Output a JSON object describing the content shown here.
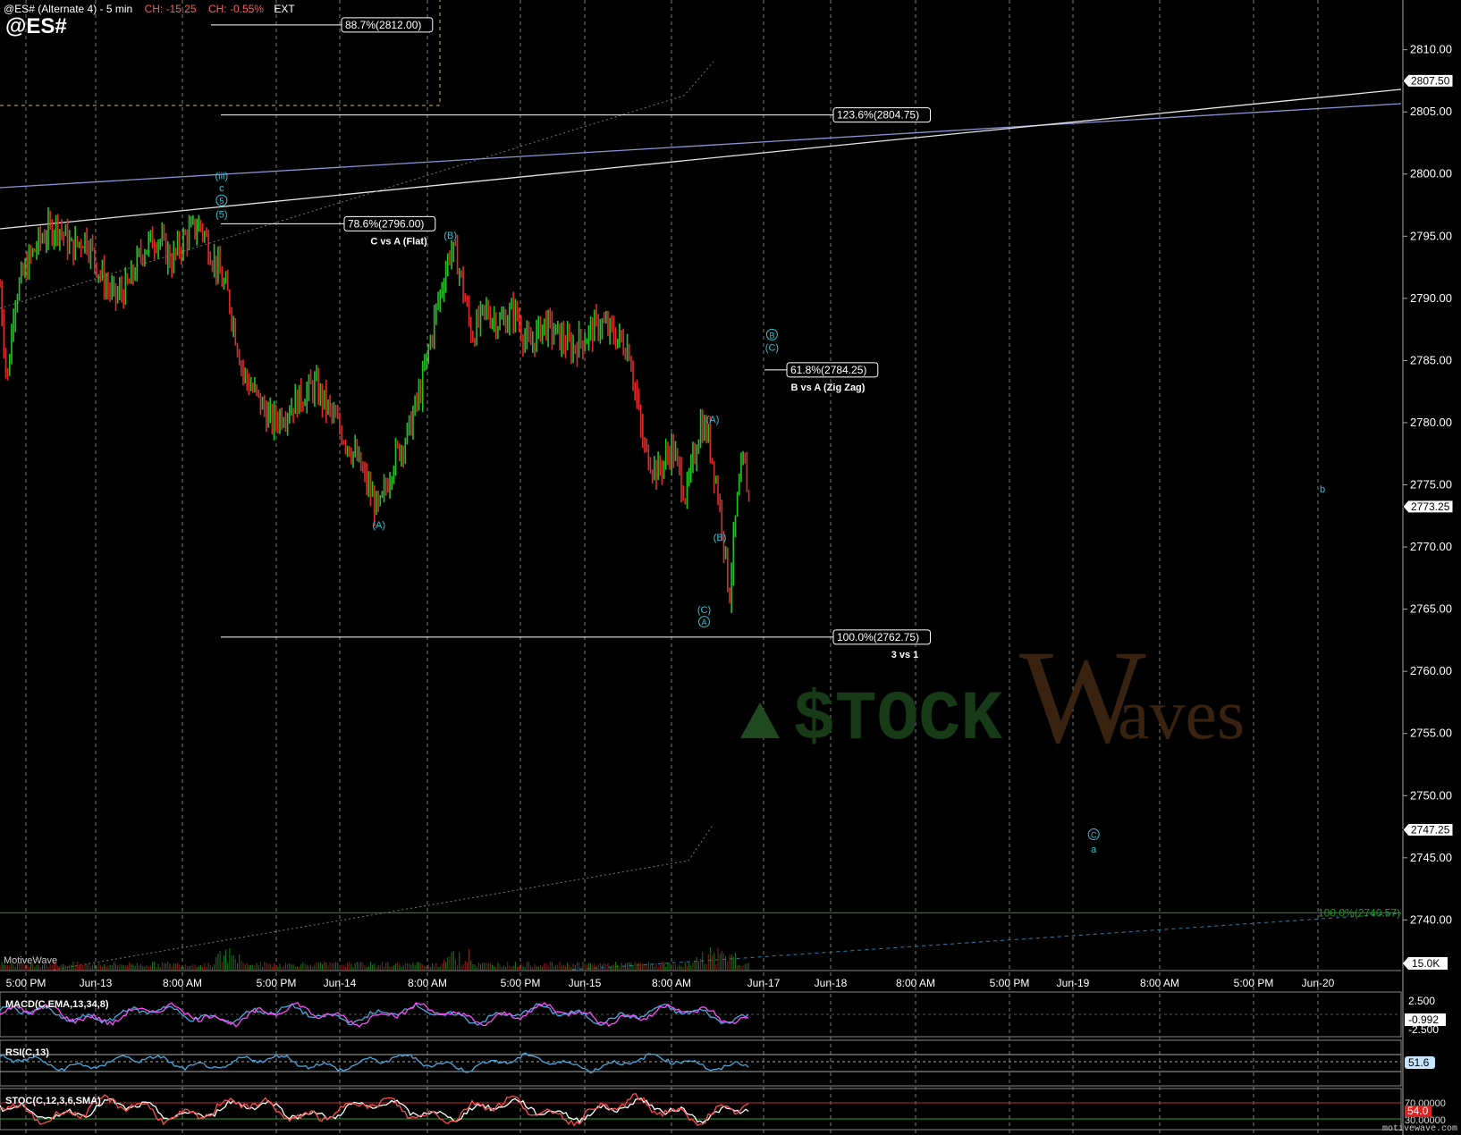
{
  "header": {
    "title": "@ES# (Alternate 4) - 5 min",
    "change_points": "CH: -15.25",
    "change_percent": "CH: -0.55%",
    "ext": "EXT",
    "symbol": "@ES#"
  },
  "brand": "MotiveWave",
  "site": "motivewave.com",
  "watermark": {
    "left": "$TOCK",
    "right_initial": "W",
    "right_rest": "aves"
  },
  "colors": {
    "background": "#000000",
    "up_bar": "#22c522",
    "down_bar": "#e02b2b",
    "wave_label": "#2fc6dc",
    "grid": "#9a9a9a",
    "channel_blue": "#8d94d6",
    "trend_white": "#e6e6e6",
    "fib_green": "#1f9a1f",
    "macd_line": "#ff4dff",
    "signal_line": "#46a9e0",
    "rsi_line": "#46a9e0",
    "stoch_k": "#ff4d4d",
    "stoch_d": "#ffffff"
  },
  "chart_data": {
    "type": "candlestick",
    "title": "@ES# (Alternate 4) - 5 min",
    "interval": "5 min",
    "ylim": [
      2736,
      2814
    ],
    "y_ticks": [
      "2740.00",
      "2745.00",
      "2750.00",
      "2755.00",
      "2760.00",
      "2765.00",
      "2770.00",
      "2775.00",
      "2780.00",
      "2785.00",
      "2790.00",
      "2795.00",
      "2800.00",
      "2805.00",
      "2810.00"
    ],
    "x_ticks": [
      "5:00 PM",
      "Jun-13",
      "8:00 AM",
      "5:00 PM",
      "Jun-14",
      "8:00 AM",
      "5:00 PM",
      "Jun-15",
      "8:00 AM",
      "Jun-17",
      "Jun-18",
      "8:00 AM",
      "5:00 PM",
      "Jun-19",
      "8:00 AM",
      "5:00 PM",
      "Jun-20"
    ],
    "price_path": [
      {
        "t": 0,
        "p": 2791
      },
      {
        "t": 1,
        "p": 2783
      },
      {
        "t": 2,
        "p": 2790
      },
      {
        "t": 4,
        "p": 2793
      },
      {
        "t": 6,
        "p": 2795
      },
      {
        "t": 8,
        "p": 2796
      },
      {
        "t": 10,
        "p": 2794
      },
      {
        "t": 12,
        "p": 2795
      },
      {
        "t": 14,
        "p": 2792
      },
      {
        "t": 16,
        "p": 2790
      },
      {
        "t": 18,
        "p": 2791
      },
      {
        "t": 20,
        "p": 2794
      },
      {
        "t": 22,
        "p": 2795
      },
      {
        "t": 24,
        "p": 2793
      },
      {
        "t": 26,
        "p": 2795
      },
      {
        "t": 28,
        "p": 2796
      },
      {
        "t": 30,
        "p": 2793
      },
      {
        "t": 32,
        "p": 2790
      },
      {
        "t": 34,
        "p": 2784
      },
      {
        "t": 36,
        "p": 2782
      },
      {
        "t": 38,
        "p": 2780
      },
      {
        "t": 40,
        "p": 2781
      },
      {
        "t": 42,
        "p": 2782
      },
      {
        "t": 44,
        "p": 2783
      },
      {
        "t": 46,
        "p": 2781
      },
      {
        "t": 48,
        "p": 2779
      },
      {
        "t": 50,
        "p": 2777
      },
      {
        "t": 52,
        "p": 2774
      },
      {
        "t": 53,
        "p": 2772.75
      },
      {
        "t": 55,
        "p": 2777
      },
      {
        "t": 57,
        "p": 2779
      },
      {
        "t": 59,
        "p": 2783
      },
      {
        "t": 61,
        "p": 2789
      },
      {
        "t": 63,
        "p": 2794
      },
      {
        "t": 64,
        "p": 2793
      },
      {
        "t": 66,
        "p": 2787
      },
      {
        "t": 68,
        "p": 2789
      },
      {
        "t": 70,
        "p": 2788
      },
      {
        "t": 72,
        "p": 2789
      },
      {
        "t": 74,
        "p": 2786
      },
      {
        "t": 76,
        "p": 2788
      },
      {
        "t": 78,
        "p": 2787
      },
      {
        "t": 80,
        "p": 2786
      },
      {
        "t": 82,
        "p": 2787
      },
      {
        "t": 84,
        "p": 2788
      },
      {
        "t": 86,
        "p": 2787
      },
      {
        "t": 88,
        "p": 2786
      },
      {
        "t": 90,
        "p": 2778
      },
      {
        "t": 92,
        "p": 2776
      },
      {
        "t": 94,
        "p": 2778
      },
      {
        "t": 96,
        "p": 2774
      },
      {
        "t": 98,
        "p": 2780
      },
      {
        "t": 99,
        "p": 2779
      },
      {
        "t": 100,
        "p": 2776
      },
      {
        "t": 101,
        "p": 2772
      },
      {
        "t": 102,
        "p": 2766
      },
      {
        "t": 103,
        "p": 2773
      },
      {
        "t": 104,
        "p": 2777
      },
      {
        "t": 105,
        "p": 2773
      }
    ],
    "horizontal_levels": [
      {
        "label": "88.7%(2812.00)",
        "price": 2812.0
      },
      {
        "label": "123.6%(2804.75)",
        "price": 2804.75
      },
      {
        "label": "78.6%(2796.00)",
        "price": 2796.0,
        "sub": "C vs A (Flat)"
      },
      {
        "label": "61.8%(2784.25)",
        "price": 2784.25,
        "sub": "B vs A (Zig Zag)"
      },
      {
        "label": "100.0%(2762.75)",
        "price": 2762.75,
        "sub": "3 vs 1"
      },
      {
        "label": "100.0%(2740.57)",
        "price": 2740.57
      }
    ],
    "right_axis_tags": [
      {
        "label": "2807.50",
        "price": 2807.5
      },
      {
        "label": "2773.25",
        "price": 2773.25
      },
      {
        "label": "2747.25",
        "price": 2747.25
      }
    ],
    "wave_labels": [
      {
        "text": "(iii)",
        "t": 31,
        "price": 2799.6
      },
      {
        "text": "c",
        "t": 31,
        "price": 2798.6
      },
      {
        "text": "5",
        "t": 31,
        "price": 2797.6,
        "circled": true
      },
      {
        "text": "(5)",
        "t": 31,
        "price": 2796.5
      },
      {
        "text": "(B)",
        "t": 63,
        "price": 2794.8
      },
      {
        "text": "(A)",
        "t": 53,
        "price": 2771.5
      },
      {
        "text": "(A)",
        "t": 99.7,
        "price": 2780
      },
      {
        "text": "(B)",
        "t": 100.7,
        "price": 2770.5
      },
      {
        "text": "(C)",
        "t": 98.5,
        "price": 2764.7
      },
      {
        "text": "A",
        "t": 98.5,
        "price": 2763.7,
        "circled": true
      },
      {
        "text": "B",
        "t": 108,
        "price": 2786.8,
        "circled": true
      },
      {
        "text": "(C)",
        "t": 108,
        "price": 2785.8
      },
      {
        "text": "C",
        "t": 153,
        "price": 2746.6,
        "circled": true
      },
      {
        "text": "a",
        "t": 153,
        "price": 2745.4
      },
      {
        "text": "b",
        "t": 185,
        "price": 2774.4
      }
    ],
    "volume_label": "15.0K",
    "grid": true
  },
  "panels": {
    "macd": {
      "title": "MACD(C,EMA,13,34,8)",
      "axis": [
        "2.500",
        "-2.500"
      ],
      "value": "-0.992"
    },
    "rsi": {
      "title": "RSI(C,13)",
      "value": "51.6"
    },
    "stoch": {
      "title": "STOC(C,12,3,6,SMA)",
      "axis": [
        "70.00000",
        "30.00000"
      ],
      "value": "54.0"
    }
  }
}
